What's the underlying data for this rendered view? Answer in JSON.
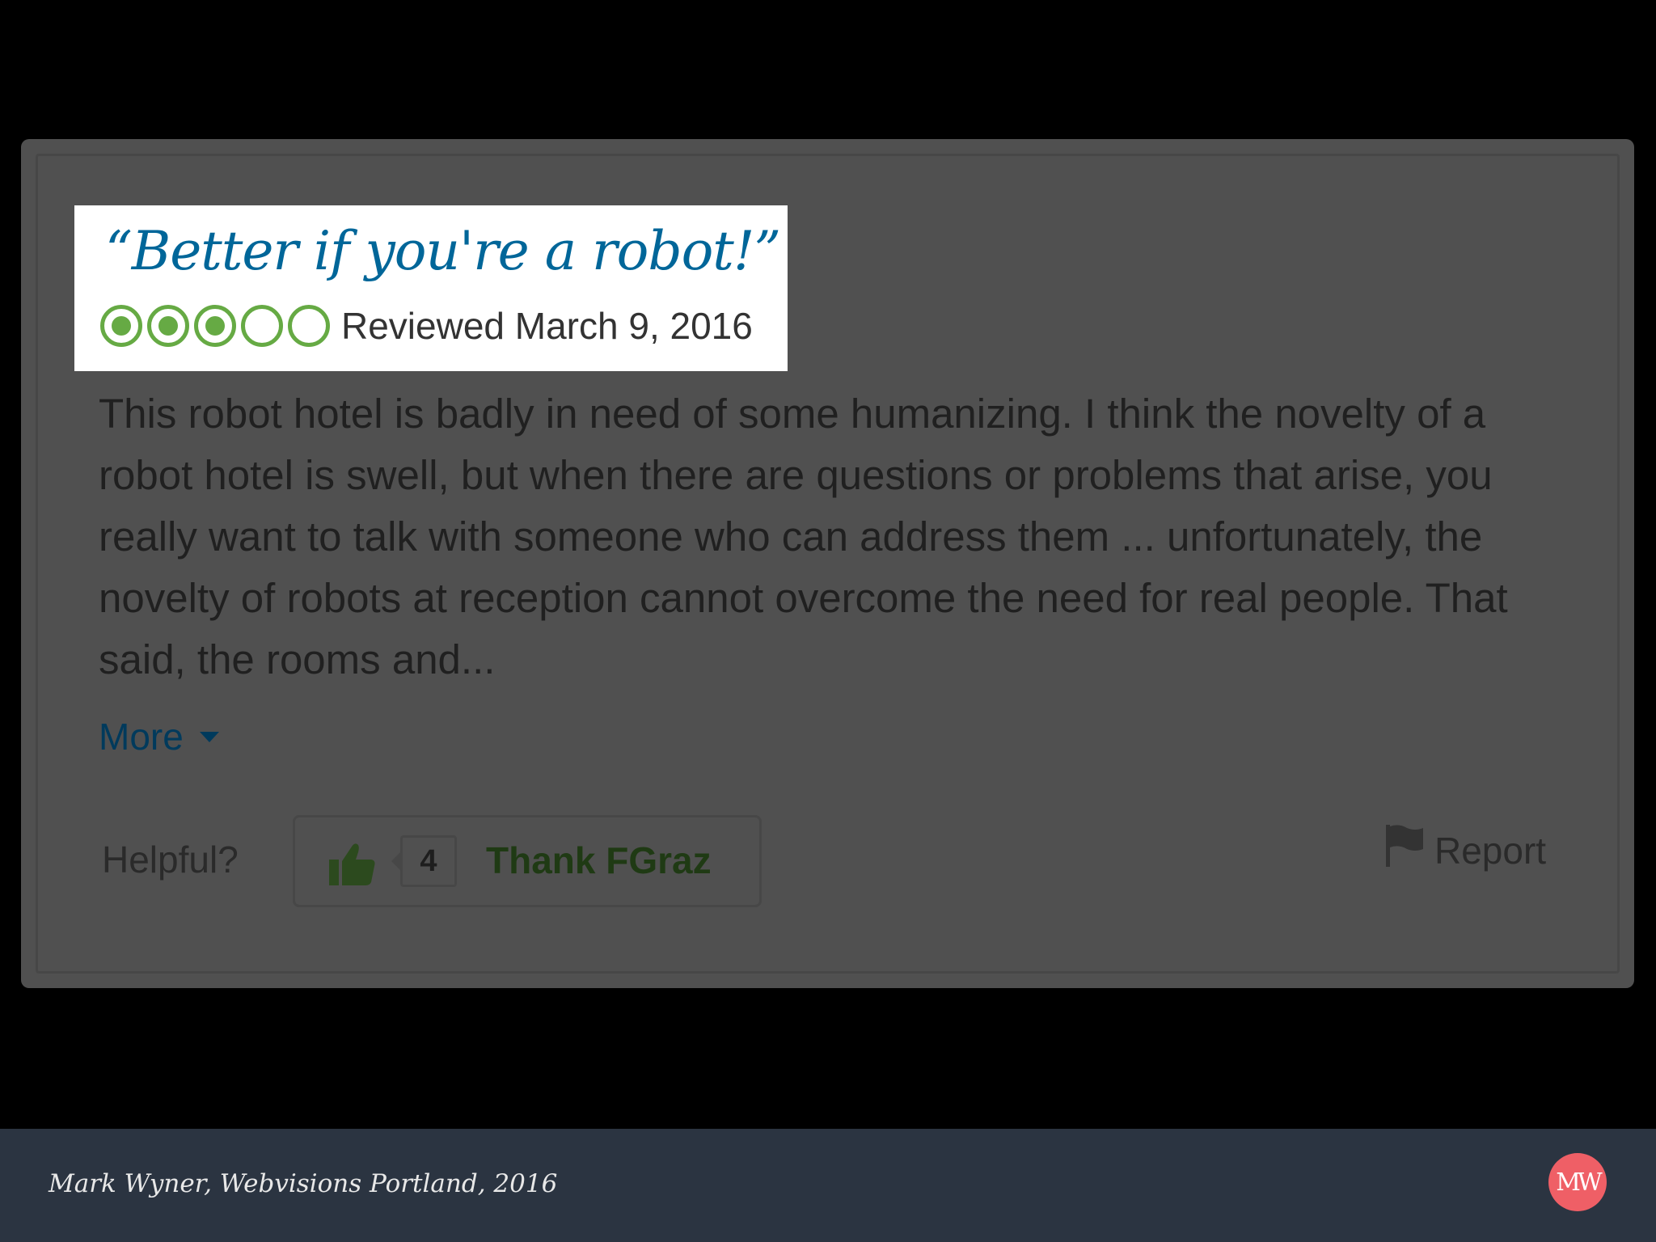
{
  "review": {
    "title": "“Better if you're a robot!”",
    "rating": {
      "value": 3,
      "max": 5,
      "color": "#66aa44"
    },
    "date": "Reviewed March 9, 2016",
    "body": "This robot hotel is badly in need of some humanizing. I think the novelty of a robot hotel is swell, but when there are questions or problems that arise, you really want to talk with someone who can address them ... unfortunately, the novelty of robots at reception cannot overcome the need for real people. That said, the rooms and...",
    "more_label": "More",
    "helpful_label": "Helpful?",
    "thank_count": "4",
    "thank_label": "Thank FGraz",
    "report_label": "Report"
  },
  "footer": {
    "credit": "Mark Wyner, Webvisions Portland, 2016",
    "logo_text": "MW",
    "logo_color": "#ef5f66"
  }
}
